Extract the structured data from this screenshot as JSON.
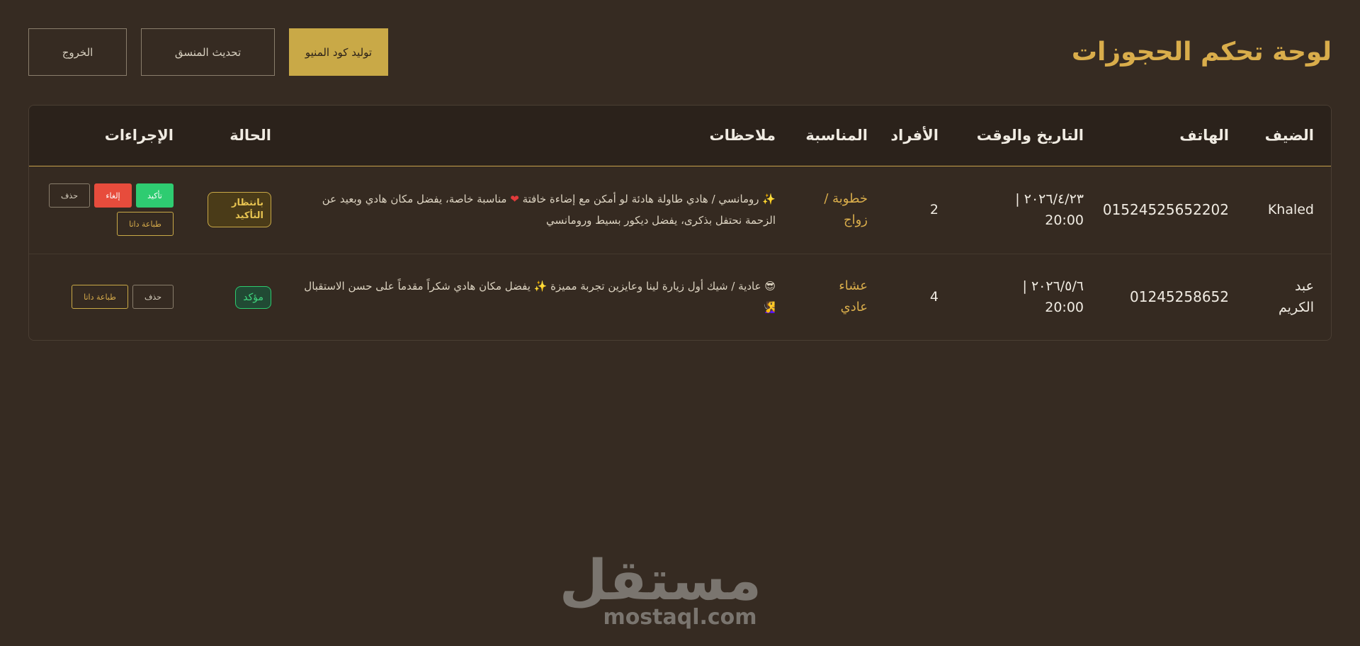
{
  "header": {
    "title": "لوحة تحكم الحجوزات",
    "btn_menu_code": "توليد كود المنيو",
    "btn_refresh": "تحديث المنسق",
    "btn_logout": "الخروج"
  },
  "table": {
    "columns": {
      "guest": "الضيف",
      "phone": "الهاتف",
      "datetime": "التاريخ والوقت",
      "people": "الأفراد",
      "occasion": "المناسبة",
      "notes": "ملاحظات",
      "status": "الحالة",
      "actions": "الإجراءات"
    },
    "rows": [
      {
        "guest": "Khaled",
        "phone": "01524525652202",
        "date": "٢٠٢٦/٤/٢٣ |",
        "time": "20:00",
        "people": "2",
        "occasion": "خطوبة / زواج",
        "notes_a": "✨ رومانسي / هادي طاولة هادئة لو أمكن مع إضاءة خافتة",
        "notes_heart": "❤",
        "notes_b": "مناسبة خاصة، يفضل مكان هادي وبعيد عن الزحمة نحتفل بذكرى، يفضل ديكور بسيط ورومانسي",
        "status": "بانتظار التأكيد",
        "btn_confirm": "تأكيد",
        "btn_cancel": "إلغاء",
        "btn_delete": "حذف",
        "btn_print": "طباعة داتا"
      },
      {
        "guest": "عبد الكريم",
        "phone": "01245258652",
        "date": "٢٠٢٦/٥/٦ |",
        "time": "20:00",
        "people": "4",
        "occasion": "عشاء عادي",
        "notes": "😎 عادية / شيك أول زيارة لينا وعايزين تجربة مميزة ✨ يفضل مكان هادي شكراً مقدماً على حسن الاستقبال 🧏‍♀️",
        "status": "مؤكد",
        "btn_delete": "حذف",
        "btn_print": "طباعة داتا"
      }
    ]
  },
  "watermark": {
    "arabic": "مستقل",
    "latin": "mostaql.com"
  },
  "colors": {
    "background": "#362b22",
    "accent": "#d9ad4b",
    "confirm": "#2ecc71",
    "cancel": "#e74c3c"
  }
}
